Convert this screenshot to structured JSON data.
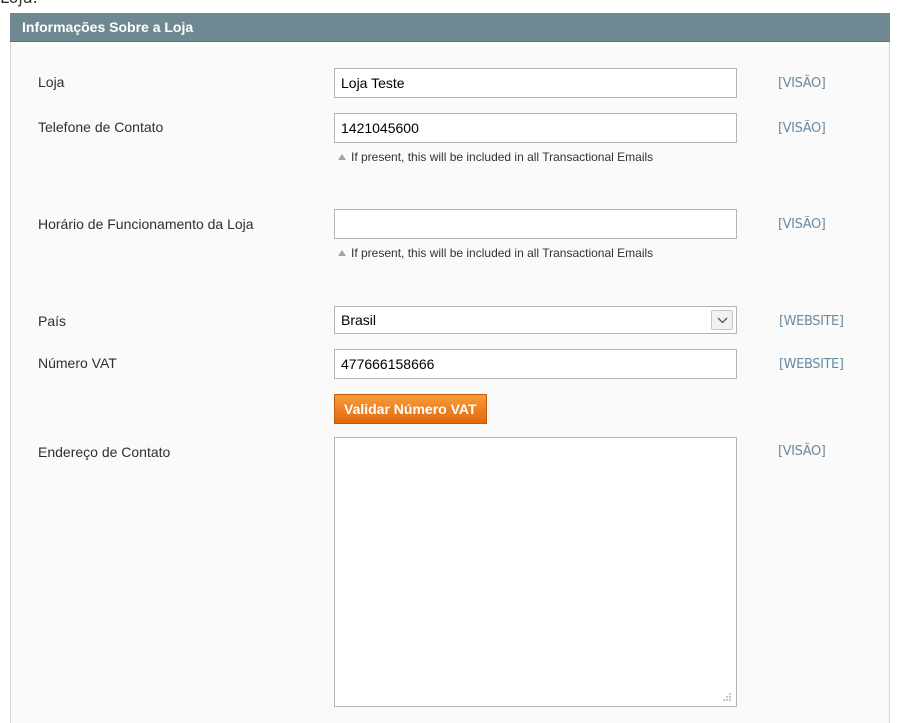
{
  "page": {
    "top_fragment": "Loja."
  },
  "section": {
    "title": "Informações Sobre a Loja"
  },
  "fields": {
    "store": {
      "label": "Loja",
      "value": "Loja Teste",
      "scope": "[VISÃO]"
    },
    "phone": {
      "label": "Telefone de Contato",
      "value": "1421045600",
      "note": "If present, this will be included in all Transactional Emails",
      "scope": "[VISÃO]"
    },
    "hours": {
      "label": "Horário de Funcionamento da Loja",
      "value": "",
      "note": "If present, this will be included in all Transactional Emails",
      "scope": "[VISÃO]"
    },
    "country": {
      "label": "País",
      "selected": "Brasil",
      "scope": "[WEBSITE]"
    },
    "vat": {
      "label": "Número VAT",
      "value": "477666158666",
      "scope": "[WEBSITE]",
      "validate_label": "Validar Número VAT"
    },
    "address": {
      "label": "Endereço de Contato",
      "value": "",
      "scope": "[VISÃO]"
    }
  },
  "icons": {
    "note": "triangle-up-icon",
    "select": "chevron-down-icon",
    "resize": "resize-grip-icon"
  },
  "colors": {
    "header_bg": "#6f8992",
    "button_orange": "#f18524",
    "scope_text": "#6a8ba0"
  }
}
